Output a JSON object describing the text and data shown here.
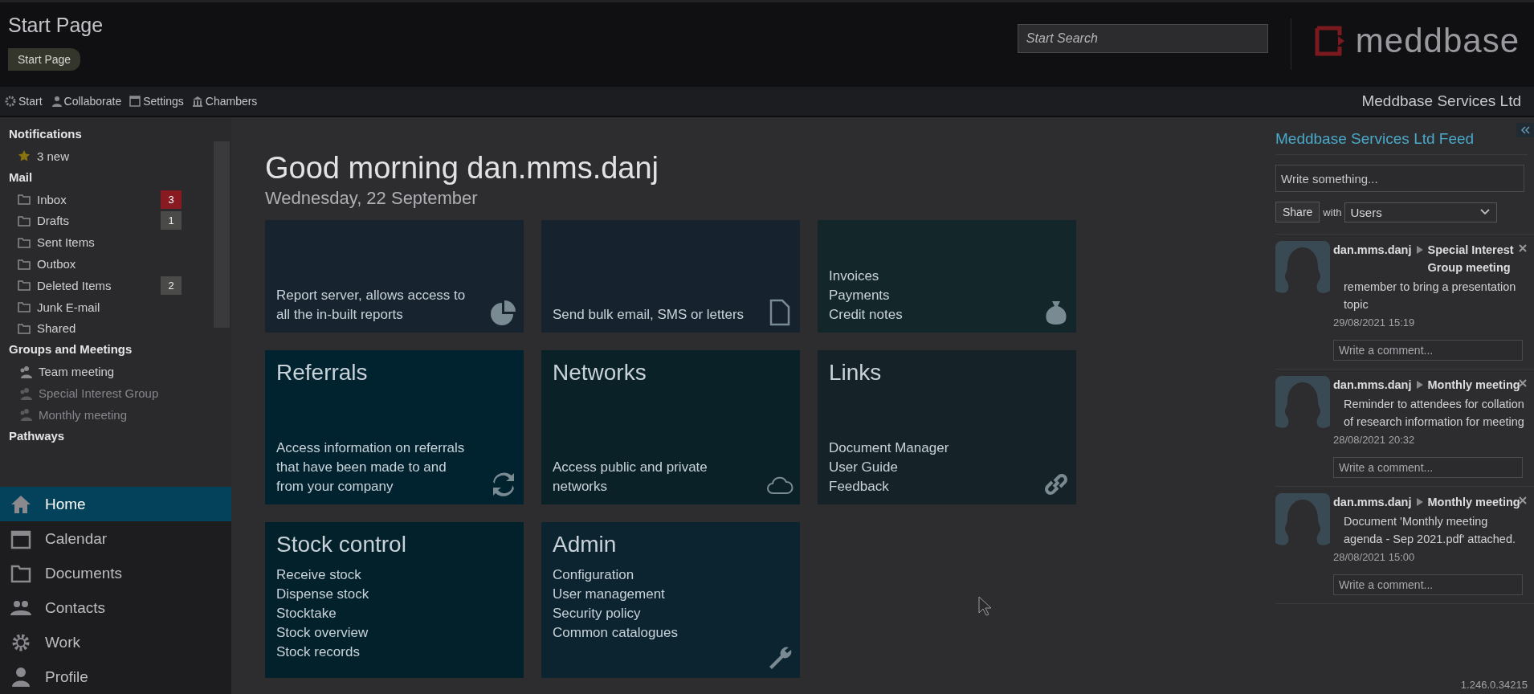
{
  "header": {
    "title": "Start Page",
    "breadcrumb": "Start Page",
    "search": {
      "placeholder": "Start Search"
    },
    "logo": "meddbase",
    "company": "Meddbase Services Ltd"
  },
  "toolbar": [
    {
      "label": "Start"
    },
    {
      "label": "Collaborate"
    },
    {
      "label": "Settings"
    },
    {
      "label": "Chambers"
    }
  ],
  "sidebar": {
    "notifications": {
      "heading": "Notifications",
      "items": [
        {
          "label": "3 new"
        }
      ]
    },
    "mail": {
      "heading": "Mail",
      "items": [
        {
          "label": "Inbox",
          "count": "3",
          "alert": true
        },
        {
          "label": "Drafts",
          "count": "1",
          "alert": false
        },
        {
          "label": "Sent Items"
        },
        {
          "label": "Outbox"
        },
        {
          "label": "Deleted Items",
          "count": "2",
          "alert": false
        },
        {
          "label": "Junk E-mail"
        },
        {
          "label": "Shared"
        }
      ]
    },
    "groups": {
      "heading": "Groups and Meetings",
      "items": [
        {
          "label": "Team meeting",
          "disabled": false
        },
        {
          "label": "Special Interest Group",
          "disabled": true
        },
        {
          "label": "Monthly meeting",
          "disabled": true
        }
      ]
    },
    "pathways": {
      "heading": "Pathways"
    },
    "nav": [
      {
        "label": "Home",
        "selected": true
      },
      {
        "label": "Calendar",
        "selected": false
      },
      {
        "label": "Documents",
        "selected": false
      },
      {
        "label": "Contacts",
        "selected": false
      },
      {
        "label": "Work",
        "selected": false
      },
      {
        "label": "Profile",
        "selected": false
      }
    ]
  },
  "greeting": "Good morning dan.mms.danj",
  "date": "Wednesday, 22 September",
  "tiles": [
    {
      "description": "Report server, allows access to all the in-built reports",
      "color": "#17232e"
    },
    {
      "description": "Send bulk email, SMS or letters",
      "color": "#16222d"
    },
    {
      "lines": [
        "Invoices",
        "Payments",
        "Credit notes"
      ],
      "color": "#13262a"
    },
    {
      "title": "Referrals",
      "description": "Access information on referrals that have been made to and from your company",
      "color": "#01222f"
    },
    {
      "title": "Networks",
      "description": "Access public and private networks",
      "color": "#0b2128"
    },
    {
      "title": "Links",
      "lines": [
        "Document Manager",
        "User Guide",
        "Feedback"
      ],
      "color": "#152328"
    },
    {
      "title": "Stock control",
      "lines": [
        "Receive stock",
        "Dispense stock",
        "Stocktake",
        "Stock overview",
        "Stock records"
      ],
      "color": "#03212b"
    },
    {
      "title": "Admin",
      "lines": [
        "Configuration",
        "User management",
        "Security policy",
        "Common catalogues"
      ],
      "color": "#0c2330"
    }
  ],
  "feed": {
    "title": "Meddbase Services Ltd Feed",
    "composer": {
      "placeholder": "Write something..."
    },
    "share": "Share",
    "with": "with",
    "audience": "Users",
    "posts": [
      {
        "author": "dan.mms.danj",
        "target": "Special Interest Group meeting",
        "body": "remember to bring a presentation topic",
        "time": "29/08/2021 15:19",
        "comment": {
          "placeholder": "Write a comment..."
        }
      },
      {
        "author": "dan.mms.danj",
        "target": "Monthly meeting",
        "body": "Reminder to attendees for collation of research information for meeting",
        "time": "28/08/2021 20:32",
        "comment": {
          "placeholder": "Write a comment..."
        }
      },
      {
        "author": "dan.mms.danj",
        "target": "Monthly meeting",
        "body": "Document 'Monthly meeting agenda - Sep 2021.pdf' attached.",
        "time": "28/08/2021 15:00",
        "comment": {
          "placeholder": "Write a comment..."
        }
      }
    ],
    "version": "1.246.0.34215"
  }
}
